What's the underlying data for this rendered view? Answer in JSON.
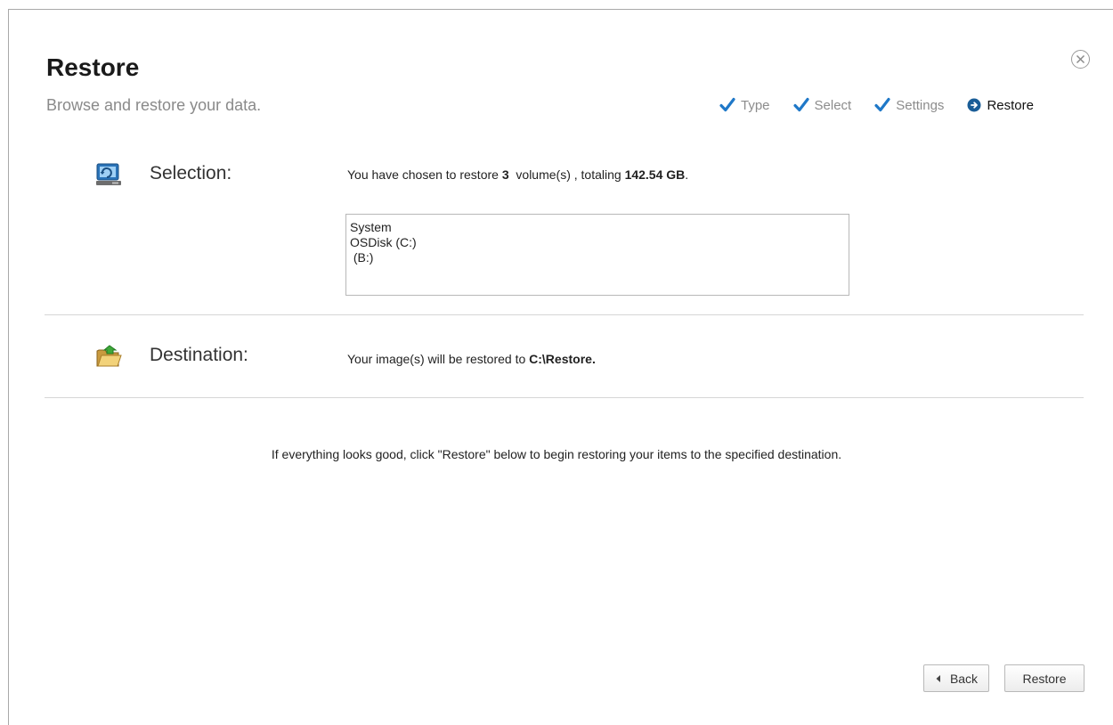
{
  "header": {
    "title": "Restore",
    "subtitle": "Browse and restore your data."
  },
  "steps": [
    {
      "label": "Type",
      "state": "done"
    },
    {
      "label": "Select",
      "state": "done"
    },
    {
      "label": "Settings",
      "state": "done"
    },
    {
      "label": "Restore",
      "state": "current"
    }
  ],
  "selection": {
    "label": "Selection:",
    "text_prefix": "You have chosen to restore ",
    "count": "3",
    "text_middle": "  volume(s) , totaling ",
    "total": "142.54 GB",
    "text_suffix": ".",
    "volumes": [
      "System",
      "OSDisk (C:)",
      " (B:)"
    ]
  },
  "destination": {
    "label": "Destination:",
    "text_prefix": "Your image(s) will be restored to ",
    "path": "C:\\Restore",
    "text_suffix": "."
  },
  "info_text": "If everything looks good, click \"Restore\" below to begin restoring your items to the specified destination.",
  "buttons": {
    "back": "Back",
    "restore": "Restore"
  },
  "colors": {
    "accent": "#1f78c8",
    "muted": "#8a8a8a"
  },
  "icons": {
    "close": "close-circle-icon",
    "selection": "monitor-restore-icon",
    "destination": "folder-icon"
  }
}
